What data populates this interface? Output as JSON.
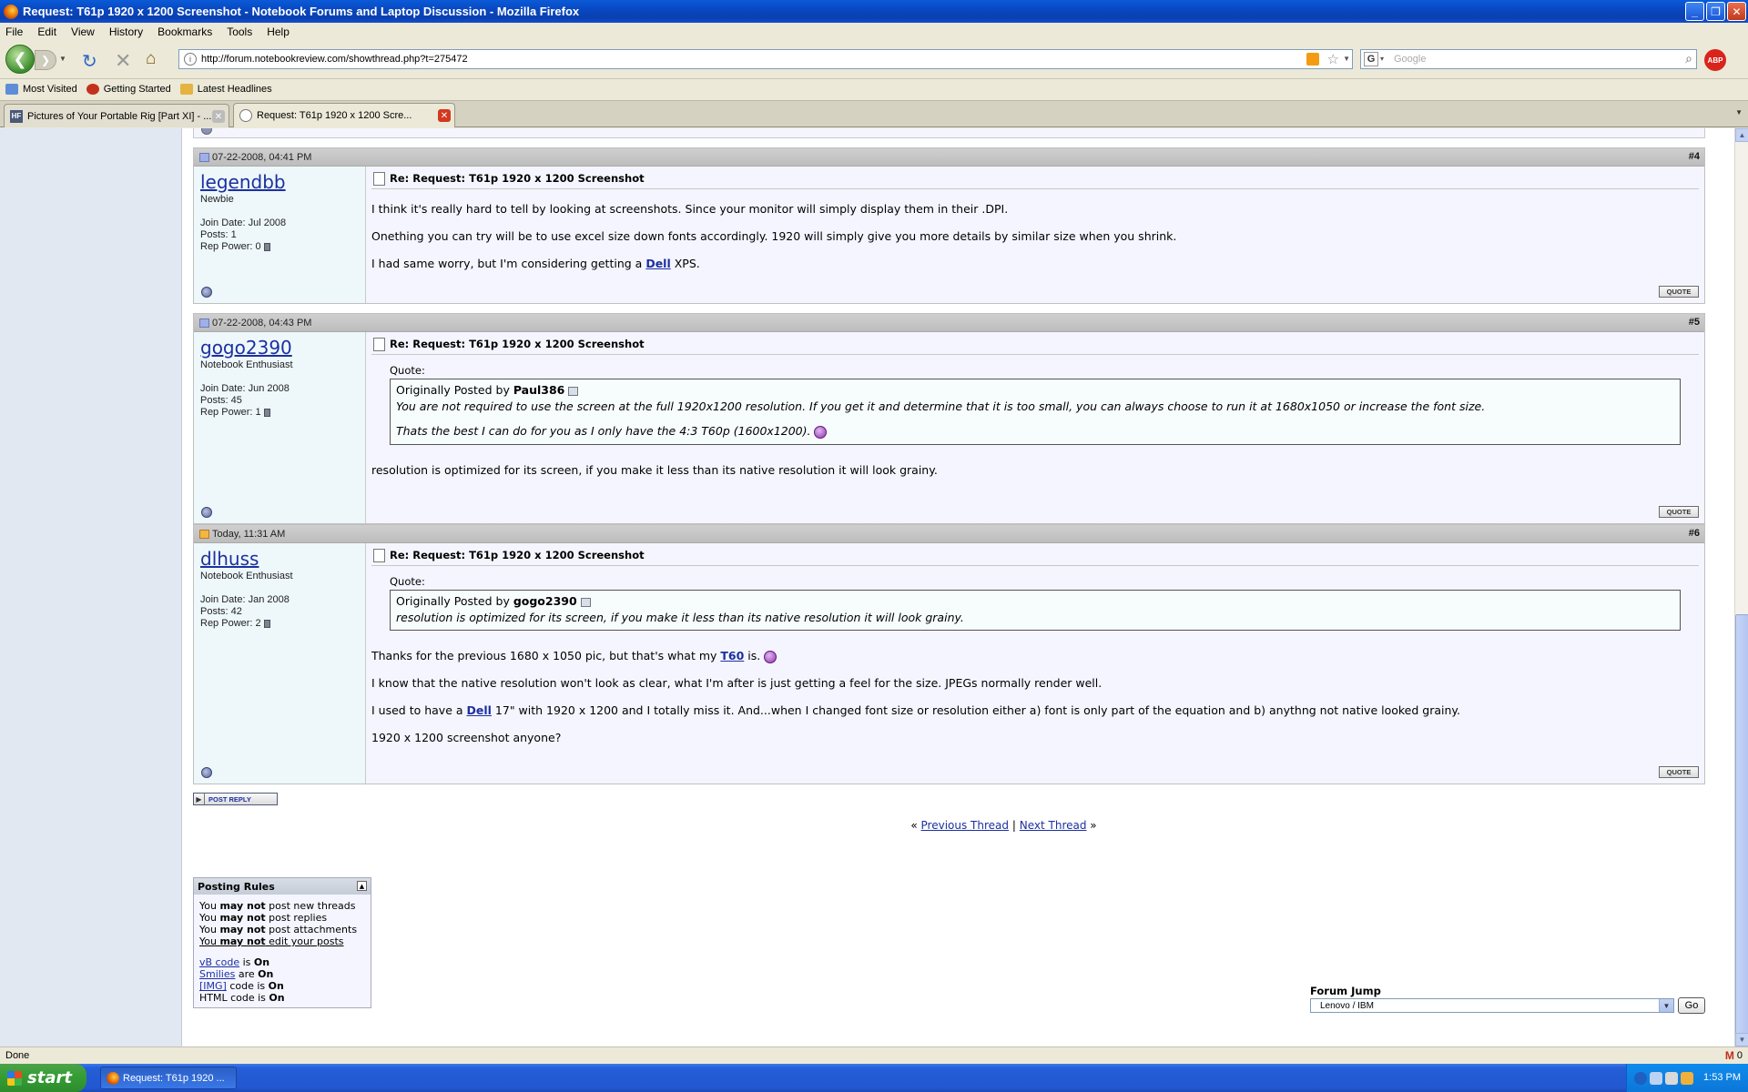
{
  "window": {
    "title": "Request: T61p 1920 x 1200 Screenshot - Notebook Forums and Laptop Discussion - Mozilla Firefox",
    "buttons": [
      "_",
      "❐",
      "✕"
    ]
  },
  "menu": [
    "File",
    "Edit",
    "View",
    "History",
    "Bookmarks",
    "Tools",
    "Help"
  ],
  "nav": {
    "url": "http://forum.notebookreview.com/showthread.php?t=275472",
    "search_placeholder": "Google",
    "abp_label": "ABP"
  },
  "bookmarks": [
    {
      "label": "Most Visited",
      "icon": "folder-icon"
    },
    {
      "label": "Getting Started",
      "icon": "firefox-icon"
    },
    {
      "label": "Latest Headlines",
      "icon": "rss-folder-icon"
    }
  ],
  "tabs": [
    {
      "label": "Pictures of Your Portable Rig [Part XI] - ...",
      "icon": "hf-icon",
      "active": false
    },
    {
      "label": "Request: T61p 1920 x 1200 Scre...",
      "icon": "page-icon",
      "active": true
    }
  ],
  "posts": [
    {
      "date": "07-22-2008, 04:41 PM",
      "number": "#4",
      "username": "legendbb",
      "user_title": "Newbie",
      "join_date": "Join Date: Jul 2008",
      "posts": "Posts: 1",
      "rep_power": "Rep Power: 0",
      "title": "Re: Request: T61p 1920 x 1200 Screenshot",
      "p1": "I think it's really hard to tell by looking at screenshots. Since your monitor will simply display them in their .DPI.",
      "p2": "Onething you can try will be to use excel size down fonts accordingly. 1920 will simply give you more details by similar size when you shrink.",
      "p3_before": "I had same worry, but I'm considering getting a ",
      "p3_link": "Dell",
      "p3_after": " XPS."
    },
    {
      "date": "07-22-2008, 04:43 PM",
      "number": "#5",
      "username": "gogo2390",
      "user_title": "Notebook Enthusiast",
      "join_date": "Join Date: Jun 2008",
      "posts": "Posts: 45",
      "rep_power": "Rep Power: 1",
      "title": "Re: Request: T61p 1920 x 1200 Screenshot",
      "quote_label": "Quote:",
      "quote_by_prefix": "Originally Posted by ",
      "quote_author": "Paul386",
      "quote_text_1": "You are not required to use the screen at the full 1920x1200 resolution. If you get it and determine that it is too small, you can always choose to run it at 1680x1050 or increase the font size.",
      "quote_text_2": "Thats the best I can do for you as I only have the 4:3 T60p (1600x1200).",
      "body": "resolution is optimized for its screen, if you make it less than its native resolution it will look grainy."
    },
    {
      "date": "Today, 11:31 AM",
      "number": "#6",
      "username": "dlhuss",
      "user_title": "Notebook Enthusiast",
      "join_date": "Join Date: Jan 2008",
      "posts": "Posts: 42",
      "rep_power": "Rep Power: 2",
      "title": "Re: Request: T61p 1920 x 1200 Screenshot",
      "quote_label": "Quote:",
      "quote_by_prefix": "Originally Posted by ",
      "quote_author": "gogo2390",
      "quote_text": "resolution is optimized for its screen, if you make it less than its native resolution it will look grainy.",
      "p1_before": "Thanks for the previous 1680 x 1050 pic, but that's what my ",
      "p1_link": "T60",
      "p1_after": " is. ",
      "p2": "I know that the native resolution won't look as clear, what I'm after is just getting a feel for the size. JPEGs normally render well.",
      "p3_before": "I used to have a ",
      "p3_link": "Dell",
      "p3_after": " 17\" with 1920 x 1200 and I totally miss it. And...when I changed font size or resolution either a) font is only part of the equation and b) anythng not native looked grainy.",
      "p4": "1920 x 1200 screenshot anyone?"
    }
  ],
  "quote_button": "QUOTE",
  "post_reply": "POST REPLY",
  "thread_nav": {
    "prev": "Previous Thread",
    "next": "Next Thread",
    "sep": "|",
    "left": "«",
    "right": "»"
  },
  "posting_rules": {
    "title": "Posting Rules",
    "lines": [
      {
        "pre": "You ",
        "bold": "may not",
        "post": " post new threads"
      },
      {
        "pre": "You ",
        "bold": "may not",
        "post": " post replies"
      },
      {
        "pre": "You ",
        "bold": "may not",
        "post": " post attachments"
      },
      {
        "pre": "You ",
        "bold": "may not",
        "post": " edit your posts"
      }
    ],
    "codes": [
      {
        "link": "vB code",
        "mid": " is ",
        "state": "On"
      },
      {
        "link": "Smilies",
        "mid": " are ",
        "state": "On"
      },
      {
        "link": "[IMG]",
        "mid": " code is ",
        "state": "On"
      },
      {
        "link": "",
        "mid": "HTML code is ",
        "state": "On"
      }
    ]
  },
  "forum_jump": {
    "label": "Forum Jump",
    "selected": "Lenovo / IBM",
    "go": "Go"
  },
  "status": {
    "text": "Done",
    "gmail_count": "0"
  },
  "taskbar": {
    "start": "start",
    "item": "Request: T61p 1920 ...",
    "clock": "1:53 PM"
  }
}
